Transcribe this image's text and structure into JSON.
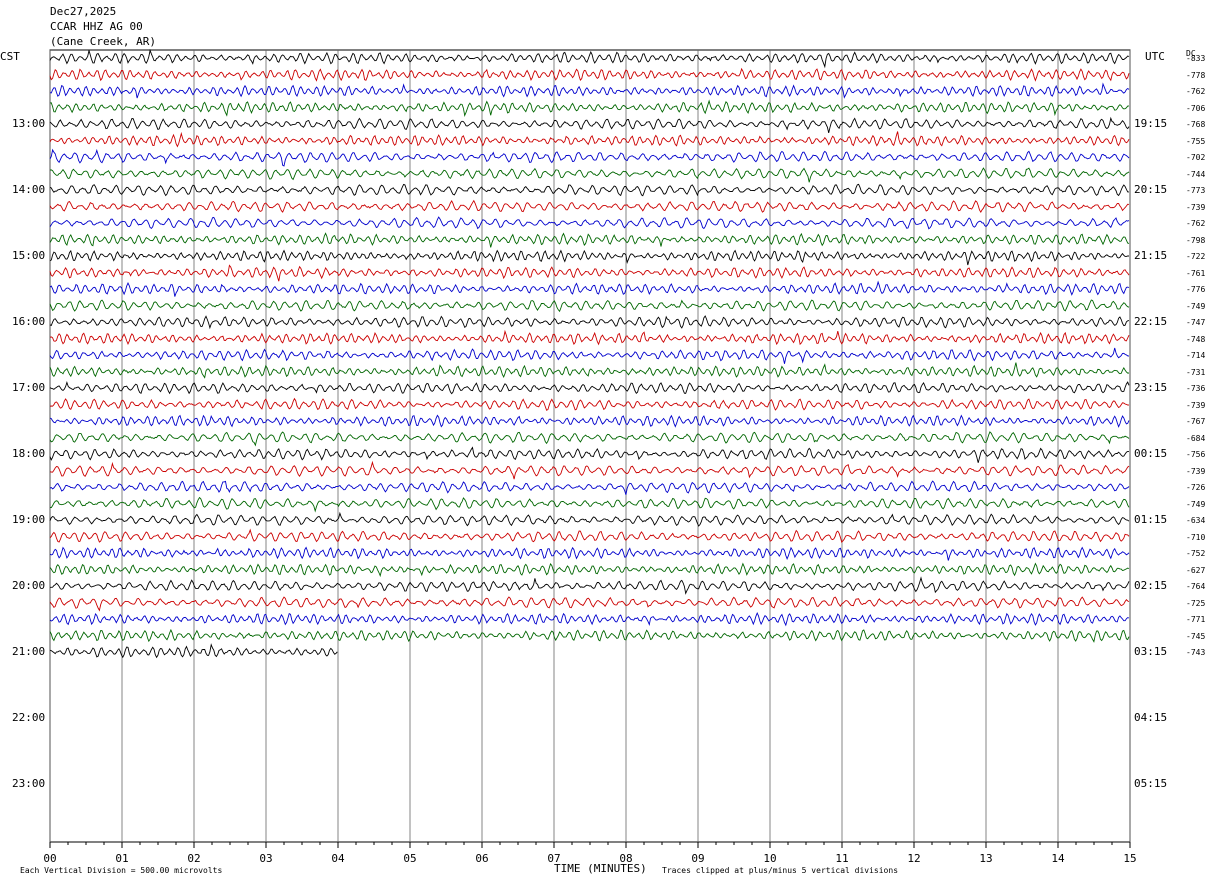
{
  "header": {
    "date": "Dec27,2025",
    "station": "CCAR HHZ AG 00",
    "location": "(Cane Creek, AR)"
  },
  "left_label": "CST",
  "right_label": "UTC",
  "dc_label": "DC",
  "footer": {
    "scale_note": "Each Vertical Division =  500.00 microvolts",
    "x_title": "TIME (MINUTES)",
    "clip_note": "Traces clipped at plus/minus 5 vertical divisions"
  },
  "chart_data": {
    "type": "line",
    "title": "",
    "xlabel": "TIME (MINUTES)",
    "ylabel": "",
    "xlim": [
      0,
      15
    ],
    "x_ticks": [
      "00",
      "01",
      "02",
      "03",
      "04",
      "05",
      "06",
      "07",
      "08",
      "09",
      "10",
      "11",
      "12",
      "13",
      "14",
      "15"
    ],
    "grid": "vertical lines at each minute",
    "cst_hours": [
      "13:00",
      "14:00",
      "15:00",
      "16:00",
      "17:00",
      "18:00",
      "19:00",
      "20:00",
      "21:00",
      "22:00",
      "23:00"
    ],
    "utc_hours": [
      "19:15",
      "20:15",
      "21:15",
      "22:15",
      "23:15",
      "00:15",
      "01:15",
      "02:15",
      "03:15",
      "04:15",
      "05:15"
    ],
    "trace_colors": [
      "#000000",
      "#cc0000",
      "#0000cc",
      "#006600"
    ],
    "traces_full": 36,
    "last_trace_minutes": 4,
    "dc_offsets": [
      "-833",
      "-778",
      "-762",
      "-706",
      "-768",
      "-755",
      "-702",
      "-744",
      "-773",
      "-739",
      "-762",
      "-798",
      "-722",
      "-761",
      "-776",
      "-749",
      "-747",
      "-748",
      "-714",
      "-731",
      "-736",
      "-739",
      "-767",
      "-684",
      "-756",
      "-739",
      "-726",
      "-749",
      "-634",
      "-710",
      "-752",
      "-627",
      "-764",
      "-725",
      "-771",
      "-745",
      "-743"
    ]
  }
}
